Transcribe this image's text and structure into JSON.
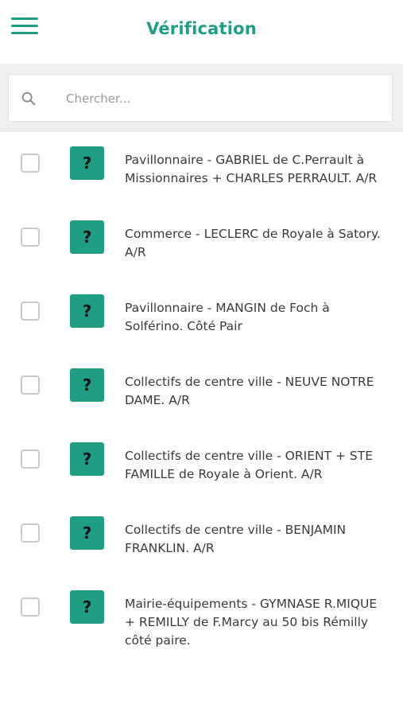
{
  "header": {
    "title": "Vérification",
    "menu_icon": "hamburger-menu-icon",
    "accent_color": "#1f9e83"
  },
  "search": {
    "placeholder": "Chercher...",
    "value": "",
    "icon": "search-icon"
  },
  "items": [
    {
      "status": "?",
      "text": "Pavillonnaire - GABRIEL de C.Perrault à Missionnaires + CHARLES PERRAULT. A/R",
      "checked": false
    },
    {
      "status": "?",
      "text": "Commerce - LECLERC de Royale à Satory. A/R",
      "checked": false
    },
    {
      "status": "?",
      "text": "Pavillonnaire - MANGIN de Foch à Solférino. Côté Pair",
      "checked": false
    },
    {
      "status": "?",
      "text": "Collectifs de centre ville - NEUVE NOTRE DAME. A/R",
      "checked": false
    },
    {
      "status": "?",
      "text": "Collectifs de centre ville - ORIENT + STE FAMILLE de Royale à Orient. A/R",
      "checked": false
    },
    {
      "status": "?",
      "text": "Collectifs de centre ville - BENJAMIN FRANKLIN. A/R",
      "checked": false
    },
    {
      "status": "?",
      "text": "Mairie-équipements - GYMNASE R.MIQUE + REMILLY de F.Marcy au 50 bis Rémilly côté paire.",
      "checked": false
    }
  ]
}
